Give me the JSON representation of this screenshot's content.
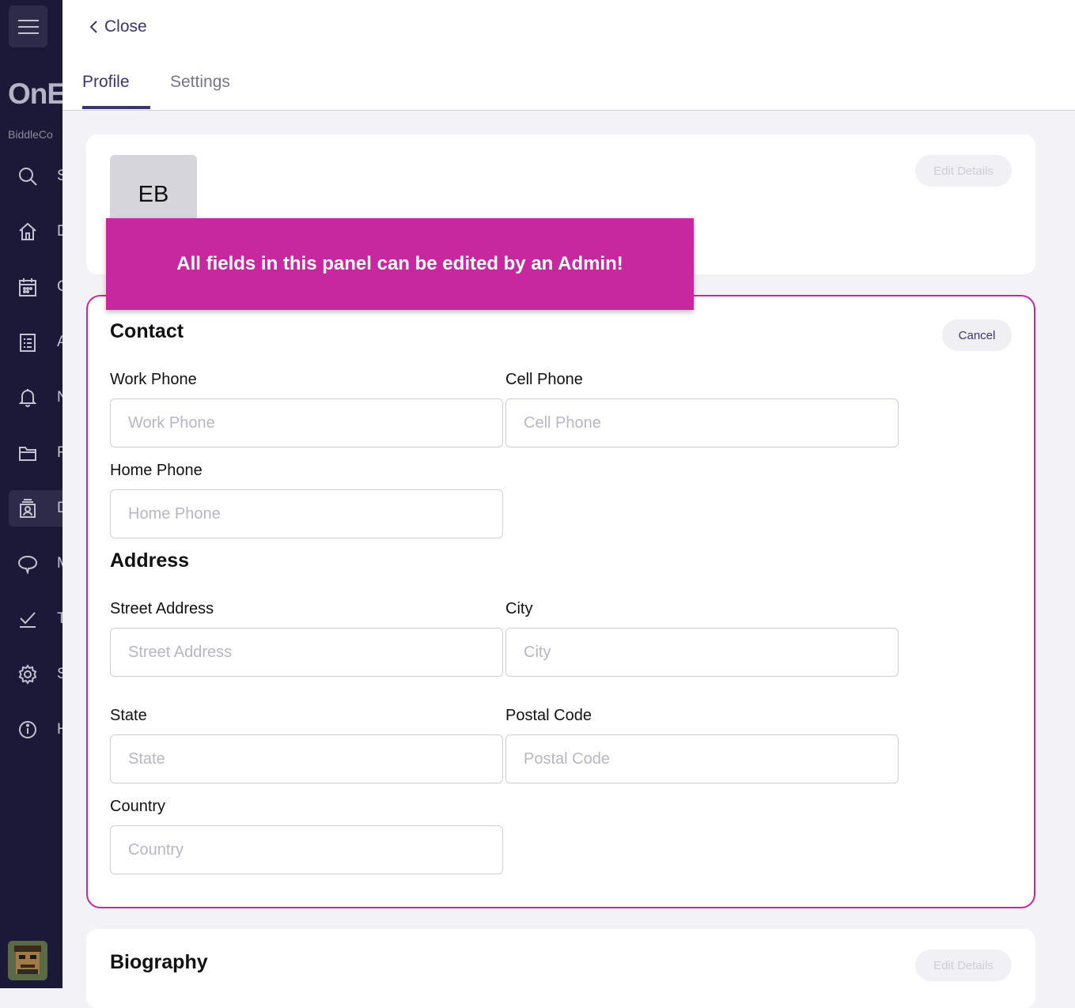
{
  "sidebar": {
    "brand": "OnE",
    "org": "BiddleCo",
    "items": [
      {
        "icon": "search-icon",
        "label": "S"
      },
      {
        "icon": "home-icon",
        "label": "D"
      },
      {
        "icon": "calendar-icon",
        "label": "C"
      },
      {
        "icon": "list-icon",
        "label": "A"
      },
      {
        "icon": "bell-icon",
        "label": "N"
      },
      {
        "icon": "folder-icon",
        "label": "R"
      },
      {
        "icon": "directory-icon",
        "label": "D"
      },
      {
        "icon": "chat-icon",
        "label": "M"
      },
      {
        "icon": "check-icon",
        "label": "T"
      },
      {
        "icon": "gear-icon",
        "label": "S"
      },
      {
        "icon": "info-icon",
        "label": "H"
      }
    ],
    "active_index": 6
  },
  "header": {
    "close_label": "Close",
    "tabs": [
      {
        "label": "Profile"
      },
      {
        "label": "Settings"
      }
    ]
  },
  "profile": {
    "initials": "EB",
    "edit_label": "Edit Details"
  },
  "callout": {
    "text": "All fields in this panel can be edited by an Admin!"
  },
  "contact": {
    "title": "Contact",
    "cancel_label": "Cancel",
    "work_phone": {
      "label": "Work Phone",
      "placeholder": "Work Phone",
      "value": ""
    },
    "cell_phone": {
      "label": "Cell Phone",
      "placeholder": "Cell Phone",
      "value": ""
    },
    "home_phone": {
      "label": "Home Phone",
      "placeholder": "Home Phone",
      "value": ""
    }
  },
  "address": {
    "title": "Address",
    "street": {
      "label": "Street Address",
      "placeholder": "Street Address",
      "value": ""
    },
    "city": {
      "label": "City",
      "placeholder": "City",
      "value": ""
    },
    "state": {
      "label": "State",
      "placeholder": "State",
      "value": ""
    },
    "postal": {
      "label": "Postal Code",
      "placeholder": "Postal Code",
      "value": ""
    },
    "country": {
      "label": "Country",
      "placeholder": "Country",
      "value": ""
    }
  },
  "biography": {
    "title": "Biography",
    "edit_label": "Edit Details"
  },
  "colors": {
    "sidebar_bg": "#1b1838",
    "accent": "#3a3570",
    "highlight": "#c7289f"
  }
}
